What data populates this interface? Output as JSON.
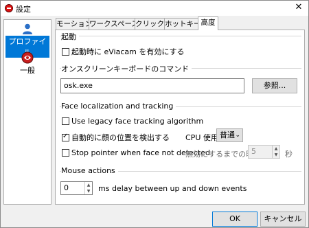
{
  "window": {
    "title": "設定",
    "close_glyph": "✕"
  },
  "sidebar": {
    "items": [
      {
        "label": "プロファイル",
        "icon": "user-icon",
        "selected": true
      },
      {
        "label": "一般",
        "icon": "eviacam-icon",
        "selected": false
      }
    ]
  },
  "tabs": [
    {
      "label": "モーション"
    },
    {
      "label": "ワークスペース"
    },
    {
      "label": "クリック"
    },
    {
      "label": "ホットキー"
    },
    {
      "label": "高度",
      "active": true
    }
  ],
  "startup": {
    "title": "起動",
    "enable_on_start_label": "起動時に eViacam を有効にする",
    "enable_on_start_checked": false
  },
  "osk": {
    "title": "オンスクリーンキーボードのコマンド",
    "command_value": "osk.exe",
    "browse_label": "参照..."
  },
  "face": {
    "title": "Face localization and tracking",
    "legacy_label": "Use legacy face tracking algorithm",
    "legacy_checked": false,
    "auto_locate_label": "自動的に顔の位置を検出する",
    "auto_locate_checked": true,
    "cpu_label": "CPU 使用",
    "cpu_value": "普通",
    "stop_pointer_label": "Stop pointer when face not detected",
    "stop_pointer_checked": false,
    "disable_time_label": "無効にするまでの時間",
    "disable_time_value": "5",
    "seconds_label": "秒"
  },
  "mouse": {
    "title": "Mouse actions",
    "delay_value": "0",
    "delay_label": "ms delay between up and down events"
  },
  "footer": {
    "ok_label": "OK",
    "cancel_label": "キャンセル(C)"
  }
}
